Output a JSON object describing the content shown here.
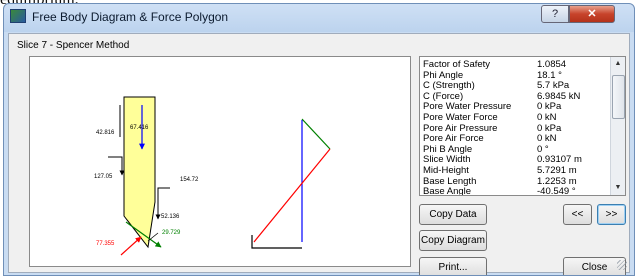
{
  "background_cut_text": "equilibrium.",
  "window": {
    "title": "Free Body Diagram & Force Polygon",
    "help_label": "?",
    "close_label": "✕"
  },
  "slice_title": "Slice 7 - Spencer Method",
  "diagram_labels": {
    "top_left": "42.816",
    "weight": "67.416",
    "left_force": "127.05",
    "right_force": "154.72",
    "base_normal": "52.136",
    "base_shear": "29.729",
    "base_red": "77.355"
  },
  "properties": [
    {
      "name": "Factor of Safety",
      "value": "1.0854"
    },
    {
      "name": "Phi Angle",
      "value": "18.1 °"
    },
    {
      "name": "C (Strength)",
      "value": "5.7 kPa"
    },
    {
      "name": "C (Force)",
      "value": "6.9845 kN"
    },
    {
      "name": "Pore Water Pressure",
      "value": "0 kPa"
    },
    {
      "name": "Pore Water Force",
      "value": "0 kN"
    },
    {
      "name": "Pore Air Pressure",
      "value": "0 kPa"
    },
    {
      "name": "Pore Air Force",
      "value": "0 kN"
    },
    {
      "name": "Phi B Angle",
      "value": "0 °"
    },
    {
      "name": "Slice Width",
      "value": "0.93107 m"
    },
    {
      "name": "Mid-Height",
      "value": "5.7291 m"
    },
    {
      "name": "Base Length",
      "value": "1.2253 m"
    },
    {
      "name": "Base Angle",
      "value": "-40.549 °"
    }
  ],
  "buttons": {
    "copy_data": "Copy Data",
    "copy_diagram": "Copy Diagram",
    "print": "Print...",
    "prev": "<<",
    "next": ">>",
    "close": "Close"
  },
  "colors": {
    "slice_fill": "#ffff99",
    "weight_arrow": "#0000ff",
    "normal_arrow": "#008000",
    "shear_arrow": "#ff0000"
  }
}
